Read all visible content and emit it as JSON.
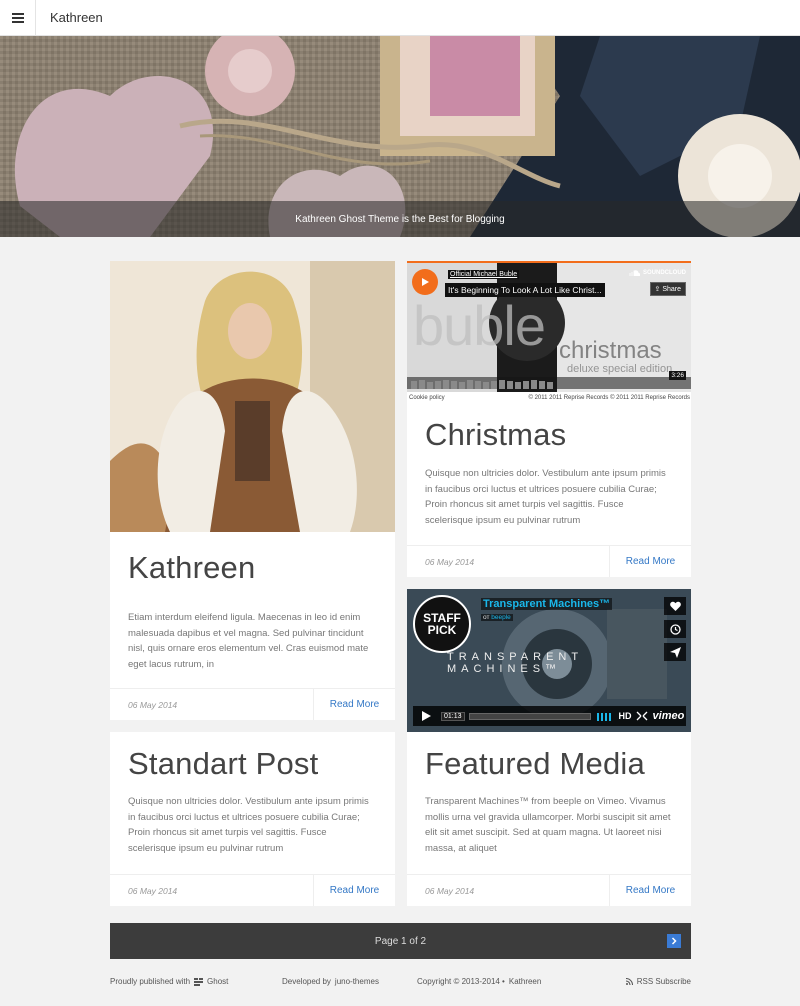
{
  "header": {
    "title": "Kathreen"
  },
  "hero": {
    "caption": "Kathreen Ghost Theme is the Best for Blogging"
  },
  "posts": [
    {
      "title": "Kathreen",
      "excerpt": "Etiam interdum eleifend ligula. Maecenas in leo id enim malesuada dapibus et vel magna. Sed pulvinar tincidunt nisl, quis ornare eros elementum vel. Cras euismod mate eget lacus rutrum, in",
      "date": "06 May 2014",
      "read_more": "Read More"
    },
    {
      "title": "Christmas",
      "excerpt": "Quisque non ultricies dolor. Vestibulum ante ipsum primis in faucibus orci luctus et ultrices posuere cubilia Curae; Proin rhoncus sit amet turpis vel sagittis. Fusce scelerisque ipsum eu pulvinar rutrum",
      "date": "06 May 2014",
      "read_more": "Read More"
    },
    {
      "title": "Featured Media",
      "excerpt": "Transparent Machines™ from beeple on Vimeo. Vivamus mollis urna vel gravida ullamcorper. Morbi suscipit sit amet elit sit amet suscipit. Sed at quam magna. Ut laoreet nisi massa, at aliquet",
      "date": "06 May 2014",
      "read_more": "Read More"
    },
    {
      "title": "Standart Post",
      "excerpt": "Quisque non ultricies dolor. Vestibulum ante ipsum primis in faucibus orci luctus et ultrices posuere cubilia Curae; Proin rhoncus sit amet turpis vel sagittis. Fusce scelerisque ipsum eu pulvinar rutrum",
      "date": "06 May 2014",
      "read_more": "Read More"
    }
  ],
  "soundcloud": {
    "artist": "Official Michael Buble",
    "track": "It's Beginning To Look A Lot Like Christ...",
    "brand": "SOUNDCLOUD",
    "share": "Share",
    "cover_word": "buble",
    "cover_word2": "christmas",
    "cover_edition": "deluxe special edition",
    "duration": "3:26",
    "cookie": "Cookie policy",
    "copyright": "© 2011 2011 Reprise Records © 2011 2011 Reprise Records"
  },
  "vimeo": {
    "title": "Transparent Machines™",
    "from_label": "от",
    "from_user": "beeple",
    "badge_line1": "STAFF",
    "badge_line2": "PICK",
    "overlay_text": "TRANSPARENT MACHINES™",
    "time": "01:13",
    "hd": "HD",
    "brand": "vimeo"
  },
  "pagination": {
    "label": "Page 1 of 2"
  },
  "footer": {
    "published": "Proudly published with",
    "ghost": "Ghost",
    "developed_prefix": "Developed by",
    "developer": "juno-themes",
    "copyright_prefix": "Copyright © 2013-2014 •",
    "copyright_link": "Kathreen",
    "rss": "RSS Subscribe"
  },
  "colors": {
    "accent": "#3478c6",
    "soundcloud_orange": "#f26d1b",
    "vimeo_blue": "#1ab7ea",
    "pager_bg": "#3c3c3c"
  }
}
